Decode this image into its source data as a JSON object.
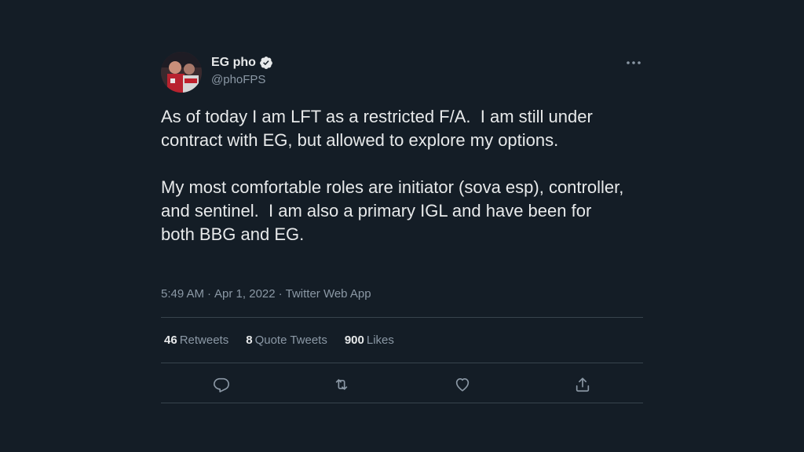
{
  "tweet": {
    "author": {
      "display_name": "EG pho",
      "handle": "@phoFPS",
      "verified": true
    },
    "text": "As of today I am LFT as a restricted F/A.  I am still under contract with EG, but allowed to explore my options.\n\nMy most comfortable roles are initiator (sova esp), controller, and sentinel.  I am also a primary IGL and have been for both BBG and EG.",
    "time": "5:49 AM",
    "separator": "·",
    "date": "Apr 1, 2022",
    "source": "Twitter Web App",
    "stats": {
      "retweets_count": "46",
      "retweets_label": "Retweets",
      "quotes_count": "8",
      "quotes_label": "Quote Tweets",
      "likes_count": "900",
      "likes_label": "Likes"
    },
    "actions": [
      "reply-icon",
      "retweet-icon",
      "like-icon",
      "share-icon"
    ]
  },
  "colors": {
    "background": "#141d26",
    "text_primary": "#e7e9ea",
    "text_secondary": "#8b98a5",
    "divider": "#38444d"
  }
}
